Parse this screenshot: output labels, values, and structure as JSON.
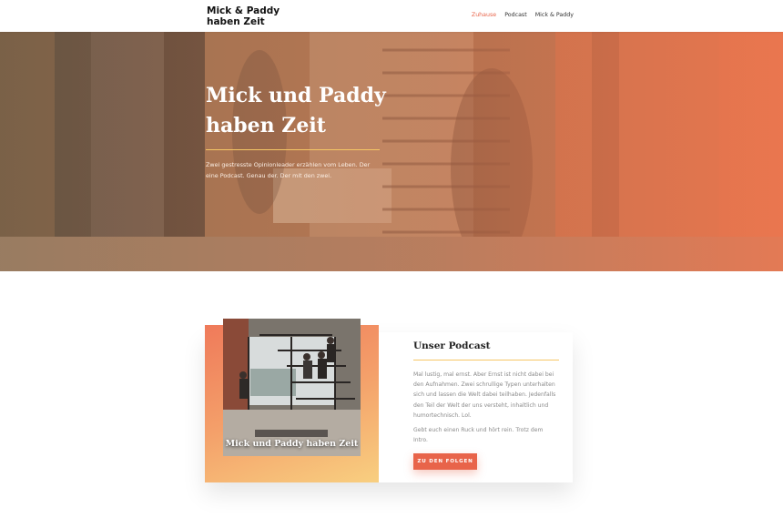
{
  "header": {
    "logo": "Mick & Paddy haben Zeit",
    "nav": [
      {
        "label": "Zuhause",
        "active": true
      },
      {
        "label": "Podcast",
        "active": false
      },
      {
        "label": "Mick & Paddy",
        "active": false
      }
    ]
  },
  "hero": {
    "title": "Mick und Paddy haben Zeit",
    "subtitle": "Zwei gestresste Opinionleader erzählen vom Leben. Der eine Podcast. Genau der. Der mit den zwei."
  },
  "podcast": {
    "cover_title": "Mick und Paddy haben Zeit",
    "heading": "Unser Podcast",
    "paragraph1": "Mal lustig, mal ernst. Aber Ernst ist nicht dabei bei den Aufnahmen. Zwei schrullige Typen unterhalten sich und lassen die Welt dabei teilhaben. Jedenfalls den Teil der Welt der uns versteht, inhaltlich und humortechnisch. Lol.",
    "paragraph2": "Gebt euch einen Ruck und hört rein. Trotz dem Intro.",
    "button": "ZU DEN FOLGEN"
  },
  "colors": {
    "accent": "#e8644a",
    "gold_line": "#f6c765"
  }
}
